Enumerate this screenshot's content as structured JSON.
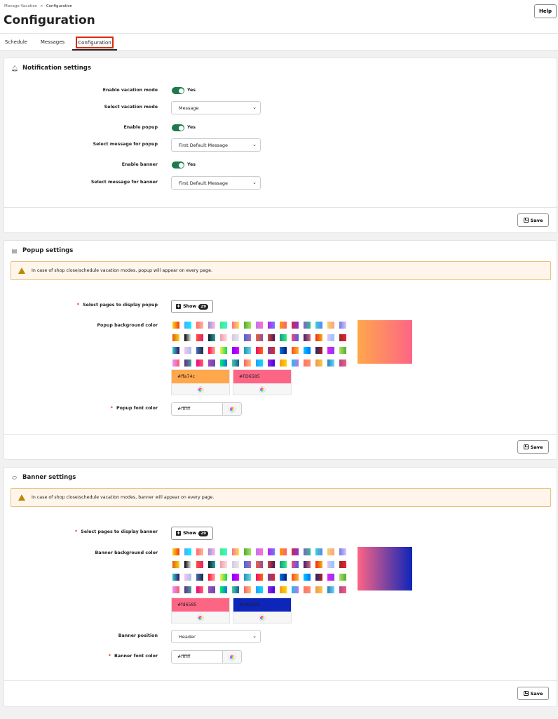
{
  "breadcrumb": {
    "parent": "Manage Vacation",
    "separator": ">",
    "current": "Configuration"
  },
  "page_title": "Configuration",
  "help_label": "Help",
  "tabs": [
    {
      "label": "Schedule",
      "active": false
    },
    {
      "label": "Messages",
      "active": false
    },
    {
      "label": "Configuration",
      "active": true
    }
  ],
  "notification": {
    "title": "Notification settings",
    "icon": "bell-icon",
    "enable_vacation_label": "Enable vacation mode",
    "enable_vacation_value": "Yes",
    "select_mode_label": "Select vacation mode",
    "select_mode_value": "Message",
    "enable_popup_label": "Enable popup",
    "enable_popup_value": "Yes",
    "popup_message_label": "Select message for popup",
    "popup_message_value": "First Default Message",
    "enable_banner_label": "Enable banner",
    "enable_banner_value": "Yes",
    "banner_message_label": "Select message for banner",
    "banner_message_value": "First Default Message",
    "save_label": "Save"
  },
  "popup": {
    "title": "Popup settings",
    "icon": "message-icon",
    "notice": "In case of shop close/schedule vacation modes, popup will appear on every page.",
    "pages_label": "Select pages to display popup",
    "show_label": "Show",
    "pages_count": "29",
    "bg_label": "Popup background color",
    "color_start": "#ffa74c",
    "color_start_text": "#ffa74c",
    "color_end": "#FD6585",
    "color_end_text": "#FD6585",
    "font_label": "Popup font color",
    "font_value": "#ffffff",
    "save_label": "Save"
  },
  "banner": {
    "title": "Banner settings",
    "icon": "tag-icon",
    "notice": "In case of shop close/schedule vacation modes, banner will appear on every page.",
    "pages_label": "Select pages to display banner",
    "show_label": "Show",
    "pages_count": "29",
    "bg_label": "Banner background color",
    "color_start": "#fd6585",
    "color_start_text": "#fd6585",
    "color_end": "#0d25b9",
    "color_end_text": "#0d25b9",
    "position_label": "Banner position",
    "position_value": "Header",
    "font_label": "Banner font color",
    "font_value": "#ffffff",
    "save_label": "Save"
  },
  "gradient_swatches": [
    [
      "#f9d423",
      "#f83600"
    ],
    [
      "#4facfe",
      "#00f2fe"
    ],
    [
      "#ff6a6a",
      "#fcb69f"
    ],
    [
      "#a18cd1",
      "#fbc2eb"
    ],
    [
      "#43e97b",
      "#38f9d7"
    ],
    [
      "#fa709a",
      "#fee140"
    ],
    [
      "#56ab2f",
      "#a8e063"
    ],
    [
      "#c471f5",
      "#fa71cd"
    ],
    [
      "#b224ef",
      "#7579ff"
    ],
    [
      "#ff9a00",
      "#ff5f6d"
    ],
    [
      "#cb2d3e",
      "#8e2de2"
    ],
    [
      "#8360c3",
      "#2ebf91"
    ],
    [
      "#36d1dc",
      "#5b86e5"
    ],
    [
      "#f6d365",
      "#fda085"
    ],
    [
      "#667eea",
      "#e0c3fc"
    ],
    [
      "#e65c00",
      "#f9d423"
    ],
    [
      "#000000",
      "#f7f8f8"
    ],
    [
      "#ff512f",
      "#dd2476"
    ],
    [
      "#0f2027",
      "#2c9f9f"
    ],
    [
      "#ee9ca7",
      "#ffdde1"
    ],
    [
      "#d3cce3",
      "#e9e4f0"
    ],
    [
      "#4568dc",
      "#b06ab3"
    ],
    [
      "#e96443",
      "#904e95"
    ],
    [
      "#c94b4b",
      "#4b134f"
    ],
    [
      "#11998e",
      "#38ef7d"
    ],
    [
      "#fc466b",
      "#3f5efb"
    ],
    [
      "#3a1c71",
      "#d76d77"
    ],
    [
      "#f12711",
      "#f5af19"
    ],
    [
      "#e0c3fc",
      "#8ec5fc"
    ],
    [
      "#93291e",
      "#ed213a"
    ],
    [
      "#30cfd0",
      "#330867"
    ],
    [
      "#fbc2eb",
      "#a6c1ee"
    ],
    [
      "#4b6cb7",
      "#182848"
    ],
    [
      "#ff0844",
      "#ffb199"
    ],
    [
      "#f9f047",
      "#0fd850"
    ],
    [
      "#7f00ff",
      "#e100ff"
    ],
    [
      "#2193b0",
      "#6dd5ed"
    ],
    [
      "#ee0979",
      "#ff6a00"
    ],
    [
      "#7b4397",
      "#dc2430"
    ],
    [
      "#0575e6",
      "#021b79"
    ],
    [
      "#fc4a1a",
      "#f7b733"
    ],
    [
      "#00c6ff",
      "#0072ff"
    ],
    [
      "#1a2a6c",
      "#b21f1f"
    ],
    [
      "#da22ff",
      "#9733ee"
    ],
    [
      "#a8e063",
      "#56ab2f"
    ],
    [
      "#f093fb",
      "#f5576c"
    ],
    [
      "#5f2c82",
      "#49a09d"
    ],
    [
      "#ec008c",
      "#fc6767"
    ],
    [
      "#9d50bb",
      "#6e48aa"
    ],
    [
      "#00f260",
      "#0575e6"
    ],
    [
      "#43cea2",
      "#185a9d"
    ],
    [
      "#ff5f6d",
      "#ffc371"
    ],
    [
      "#1fa2ff",
      "#12d8fa"
    ],
    [
      "#8e2de2",
      "#4a00e0"
    ],
    [
      "#f7971e",
      "#ffd200"
    ],
    [
      "#12c2e9",
      "#c471ed"
    ],
    [
      "#fd746c",
      "#ff9068"
    ],
    [
      "#f2994a",
      "#f2c94c"
    ],
    [
      "#2980b9",
      "#6dd5fa"
    ],
    [
      "#b24592",
      "#f15f79"
    ]
  ]
}
